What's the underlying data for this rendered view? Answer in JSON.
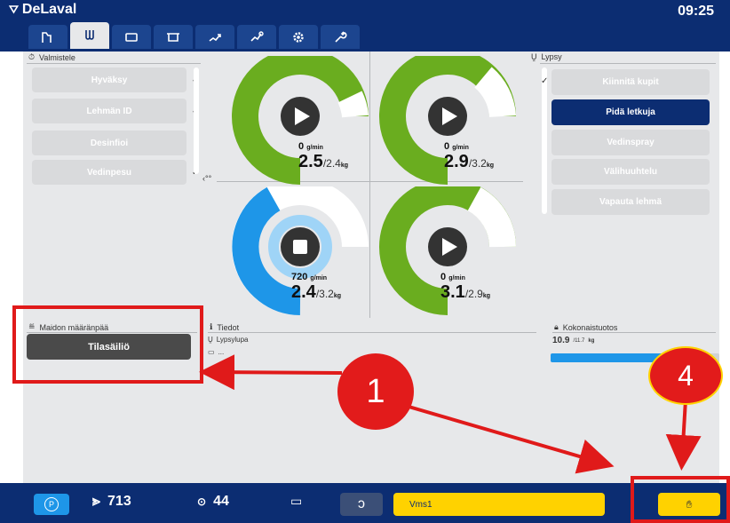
{
  "header": {
    "brand": "DeLaval",
    "time": "09:25"
  },
  "tabs": [
    {
      "icon": "animal-icon"
    },
    {
      "icon": "teatcup-icon",
      "active": true
    },
    {
      "icon": "box-icon"
    },
    {
      "icon": "tray-icon"
    },
    {
      "icon": "cow-walk-icon"
    },
    {
      "icon": "cow-run-icon"
    },
    {
      "icon": "settings-icon"
    },
    {
      "icon": "wrench-icon"
    }
  ],
  "prepare": {
    "title": "Valmistele",
    "buttons": [
      {
        "label": "Hyväksy",
        "checked": true
      },
      {
        "label": "Lehmän ID",
        "checked": true
      },
      {
        "label": "Desinfioi",
        "checked": false
      },
      {
        "label": "Vedinpesu",
        "checked": true
      }
    ]
  },
  "milking": {
    "title": "Lypsy",
    "buttons": [
      {
        "label": "Kiinnitä kupit",
        "checked": true,
        "active": false
      },
      {
        "label": "Pidä letkuja",
        "checked": false,
        "active": true
      },
      {
        "label": "Vedinspray",
        "checked": false,
        "active": false
      },
      {
        "label": "Välihuuhtelu",
        "checked": false,
        "active": false
      },
      {
        "label": "Vapauta lehmä",
        "checked": false,
        "active": false
      }
    ]
  },
  "gauges": [
    {
      "flow": "0",
      "flow_unit": "g/min",
      "amount": "2.5",
      "target": "/2.4",
      "unit": "kg",
      "state": "play",
      "color": "#6aad1f"
    },
    {
      "flow": "0",
      "flow_unit": "g/min",
      "amount": "2.9",
      "target": "/3.2",
      "unit": "kg",
      "state": "play",
      "color": "#6aad1f"
    },
    {
      "flow": "720",
      "flow_unit": "g/min",
      "amount": "2.4",
      "target": "/3.2",
      "unit": "kg",
      "state": "stop",
      "color": "#1e96e8"
    },
    {
      "flow": "0",
      "flow_unit": "g/min",
      "amount": "3.1",
      "target": "/2.9",
      "unit": "kg",
      "state": "play",
      "color": "#6aad1f"
    }
  ],
  "destination": {
    "title": "Maidon määränpää",
    "button": "Tilasäiliö"
  },
  "info": {
    "title": "Tiedot",
    "line1": "Lypsylupa",
    "line2": "..."
  },
  "total": {
    "title": "Kokonaistuotos",
    "amount": "10.9",
    "target": "/11.7",
    "unit": "kg",
    "progress": 0.93
  },
  "bottom": {
    "p_label": "P",
    "stat1": "713",
    "stat2": "44",
    "vms": "Vms1"
  },
  "annotations": {
    "marker1": "1",
    "marker4": "4"
  },
  "colors": {
    "brand": "#0c2d72",
    "accent": "#ffd200",
    "green": "#6aad1f",
    "blue": "#1e96e8",
    "red": "#e01a1a"
  }
}
